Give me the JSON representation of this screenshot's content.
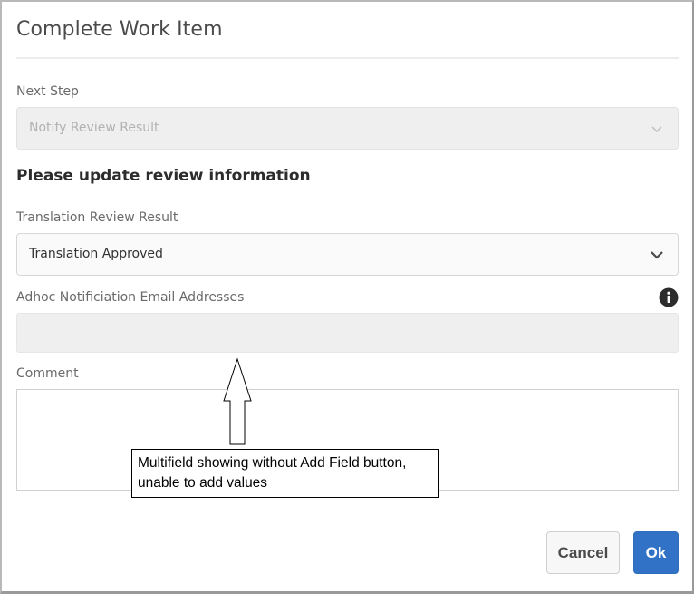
{
  "dialog": {
    "title": "Complete Work Item"
  },
  "next_step": {
    "label": "Next Step",
    "value": "Notify Review Result",
    "disabled": true
  },
  "section_heading": "Please update review information",
  "review_result": {
    "label": "Translation Review Result",
    "value": "Translation Approved"
  },
  "adhoc_emails": {
    "label": "Adhoc Notificiation Email Addresses",
    "info_icon": "info-icon"
  },
  "comment": {
    "label": "Comment",
    "value": ""
  },
  "annotation": {
    "text": "Multifield showing without Add Field button, unable to add values",
    "line1": "Multifield showing without Add Field button,",
    "line2": "unable to add values"
  },
  "actions": {
    "cancel_label": "Cancel",
    "ok_label": "Ok"
  },
  "colors": {
    "primary": "#3172c7",
    "disabled_bg": "#efefef"
  }
}
